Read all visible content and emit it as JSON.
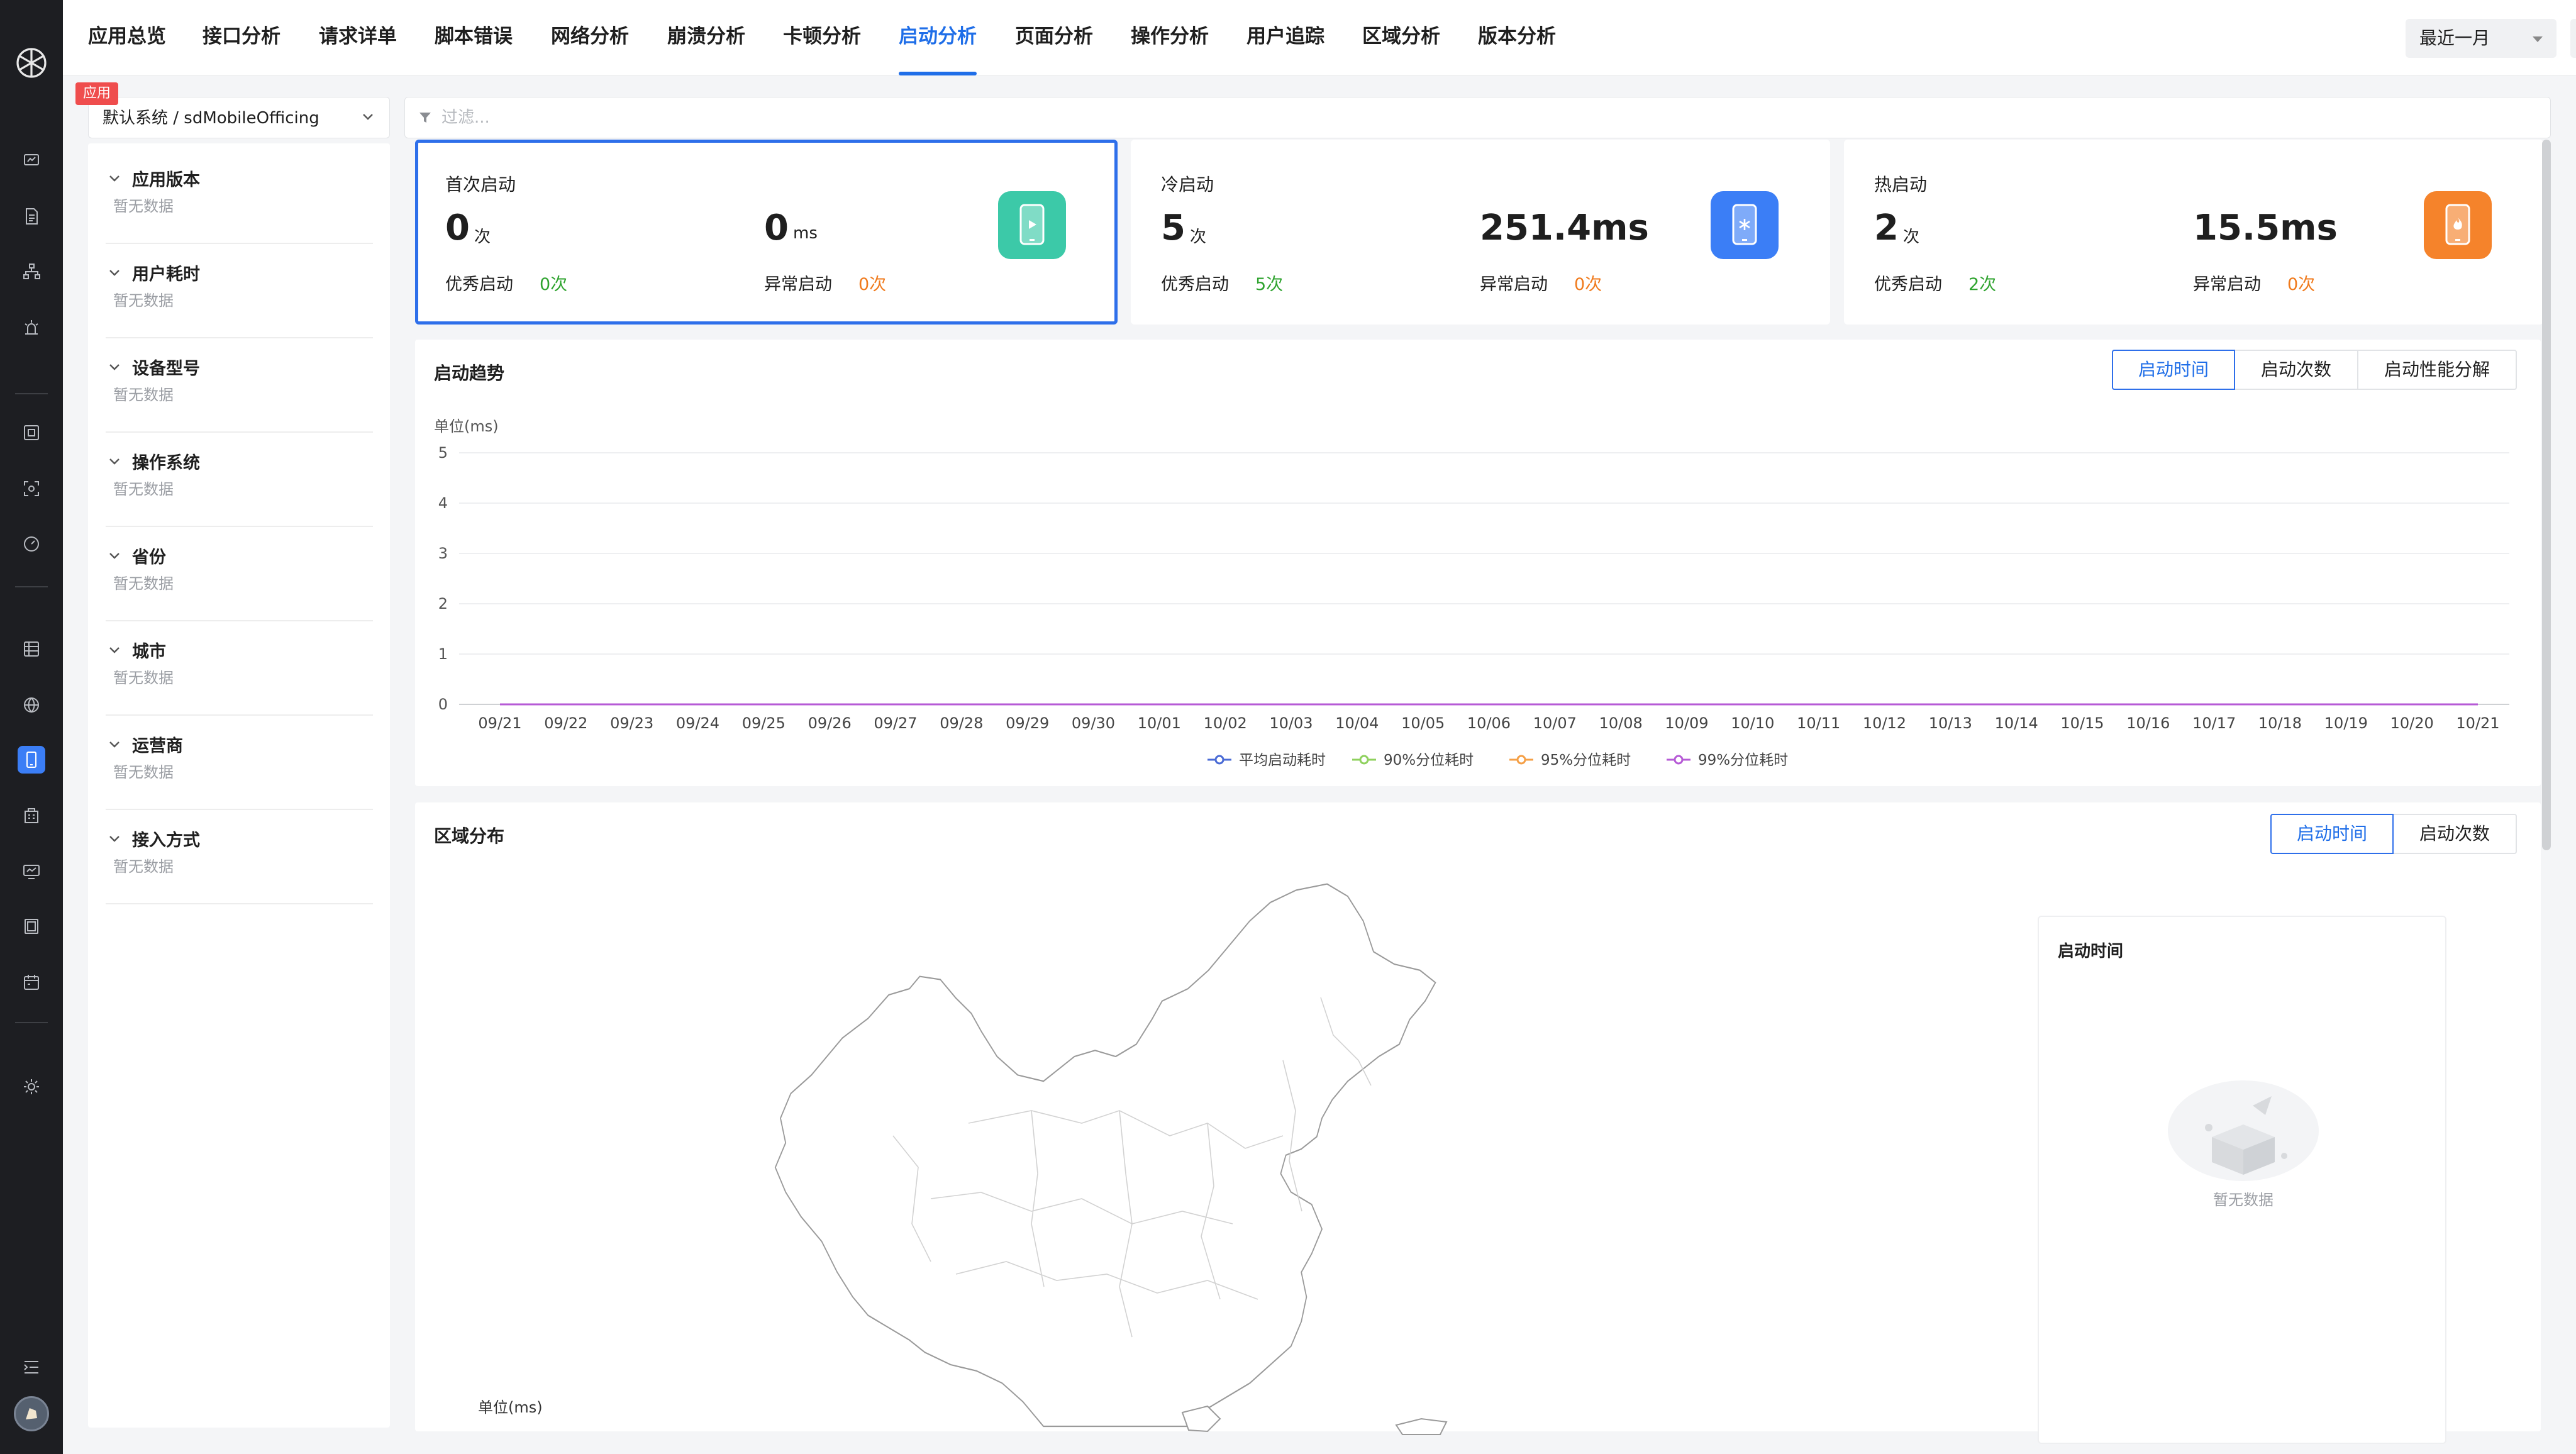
{
  "nav": {
    "tabs": [
      "应用总览",
      "接口分析",
      "请求详单",
      "脚本错误",
      "网络分析",
      "崩溃分析",
      "卡顿分析",
      "启动分析",
      "页面分析",
      "操作分析",
      "用户追踪",
      "区域分析",
      "版本分析"
    ],
    "active_tab": "启动分析",
    "time_range": "最近一月"
  },
  "rail": {
    "icons": [
      "dashboard-icon",
      "document-icon",
      "topology-icon",
      "alert-icon",
      "monitor-icon",
      "scan-icon",
      "gauge-icon",
      "database-icon",
      "globe-icon",
      "mobile-icon",
      "building-icon",
      "screen-icon",
      "server-icon",
      "calendar-icon",
      "settings-icon",
      "collapse-menu-icon"
    ],
    "active_icon": "mobile-icon"
  },
  "filter": {
    "app_badge": "应用",
    "app_value": "默认系统 / sdMobileOfficing",
    "placeholder": "过滤..."
  },
  "left_panel": {
    "groups": [
      {
        "title": "应用版本",
        "empty": "暂无数据"
      },
      {
        "title": "用户耗时",
        "empty": "暂无数据"
      },
      {
        "title": "设备型号",
        "empty": "暂无数据"
      },
      {
        "title": "操作系统",
        "empty": "暂无数据"
      },
      {
        "title": "省份",
        "empty": "暂无数据"
      },
      {
        "title": "城市",
        "empty": "暂无数据"
      },
      {
        "title": "运营商",
        "empty": "暂无数据"
      },
      {
        "title": "接入方式",
        "empty": "暂无数据"
      }
    ]
  },
  "cards": [
    {
      "title": "首次启动",
      "count": "0",
      "count_unit": "次",
      "time": "0",
      "time_unit": "ms",
      "good_label": "优秀启动",
      "good_value": "0次",
      "bad_label": "异常启动",
      "bad_value": "0次",
      "icon": "phone-play-icon",
      "color": "#3cc9a8",
      "selected": true
    },
    {
      "title": "冷启动",
      "count": "5",
      "count_unit": "次",
      "time": "251.4ms",
      "time_unit": "",
      "good_label": "优秀启动",
      "good_value": "5次",
      "bad_label": "异常启动",
      "bad_value": "0次",
      "icon": "phone-snowflake-icon",
      "color": "#3b7ef6",
      "selected": false
    },
    {
      "title": "热启动",
      "count": "2",
      "count_unit": "次",
      "time": "15.5ms",
      "time_unit": "",
      "good_label": "优秀启动",
      "good_value": "2次",
      "bad_label": "异常启动",
      "bad_value": "0次",
      "icon": "phone-flame-icon",
      "color": "#f5832b",
      "selected": false
    }
  ],
  "trend": {
    "title": "启动趋势",
    "toggles": [
      "启动时间",
      "启动次数",
      "启动性能分解"
    ],
    "active_toggle": "启动时间"
  },
  "chart_data": {
    "type": "line",
    "ylabel": "单位(ms)",
    "ylim": [
      0,
      5
    ],
    "y_ticks": [
      0,
      1,
      2,
      3,
      4,
      5
    ],
    "categories": [
      "09/21",
      "09/22",
      "09/23",
      "09/24",
      "09/25",
      "09/26",
      "09/27",
      "09/28",
      "09/29",
      "09/30",
      "10/01",
      "10/02",
      "10/03",
      "10/04",
      "10/05",
      "10/06",
      "10/07",
      "10/08",
      "10/09",
      "10/10",
      "10/11",
      "10/12",
      "10/13",
      "10/14",
      "10/15",
      "10/16",
      "10/17",
      "10/18",
      "10/19",
      "10/20",
      "10/21"
    ],
    "series": [
      {
        "name": "平均启动耗时",
        "color": "#4a6bd6",
        "values": [
          0,
          0,
          0,
          0,
          0,
          0,
          0,
          0,
          0,
          0,
          0,
          0,
          0,
          0,
          0,
          0,
          0,
          0,
          0,
          0,
          0,
          0,
          0,
          0,
          0,
          0,
          0,
          0,
          0,
          0,
          0
        ]
      },
      {
        "name": "90%分位耗时",
        "color": "#8fd15e",
        "values": [
          0,
          0,
          0,
          0,
          0,
          0,
          0,
          0,
          0,
          0,
          0,
          0,
          0,
          0,
          0,
          0,
          0,
          0,
          0,
          0,
          0,
          0,
          0,
          0,
          0,
          0,
          0,
          0,
          0,
          0,
          0
        ]
      },
      {
        "name": "95%分位耗时",
        "color": "#f5a047",
        "values": [
          0,
          0,
          0,
          0,
          0,
          0,
          0,
          0,
          0,
          0,
          0,
          0,
          0,
          0,
          0,
          0,
          0,
          0,
          0,
          0,
          0,
          0,
          0,
          0,
          0,
          0,
          0,
          0,
          0,
          0,
          0
        ]
      },
      {
        "name": "99%分位耗时",
        "color": "#b65ad6",
        "values": [
          0,
          0,
          0,
          0,
          0,
          0,
          0,
          0,
          0,
          0,
          0,
          0,
          0,
          0,
          0,
          0,
          0,
          0,
          0,
          0,
          0,
          0,
          0,
          0,
          0,
          0,
          0,
          0,
          0,
          0,
          0
        ]
      }
    ],
    "legend": "bottom",
    "grid": true
  },
  "region": {
    "title": "区域分布",
    "toggles": [
      "启动时间",
      "启动次数"
    ],
    "active_toggle": "启动时间",
    "rank_title": "启动时间",
    "rank_empty": "暂无数据",
    "map_unit": "单位(ms)"
  }
}
